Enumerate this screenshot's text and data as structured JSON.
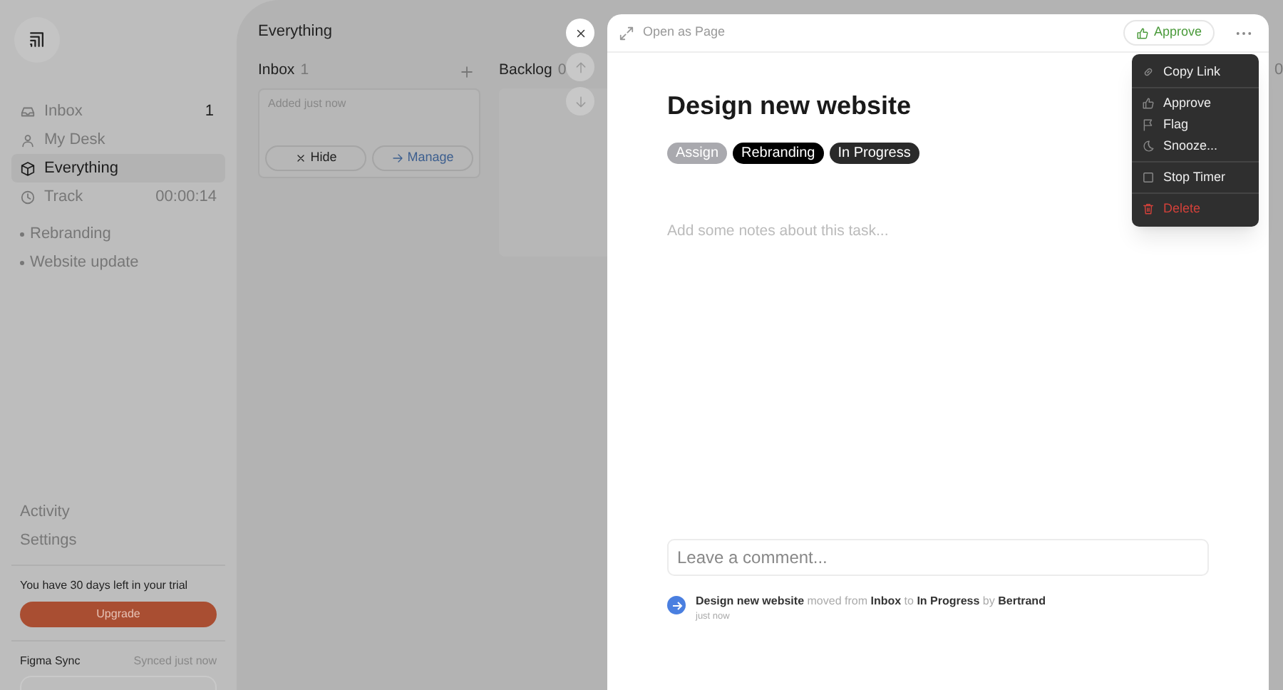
{
  "sidebar": {
    "nav": [
      {
        "label": "Inbox",
        "badge": "1",
        "selected": false
      },
      {
        "label": "My Desk",
        "selected": false
      },
      {
        "label": "Everything",
        "selected": true
      },
      {
        "label": "Track",
        "badge": "00:00:14",
        "selected": false
      }
    ],
    "projects": [
      "Rebranding",
      "Website update"
    ],
    "footer_links": [
      "Activity",
      "Settings"
    ],
    "trial": {
      "text": "You have 30 days left in your trial",
      "button": "Upgrade"
    },
    "sync": {
      "label": "Figma Sync",
      "status": "Synced just now"
    }
  },
  "board": {
    "title": "Everything",
    "columns": [
      {
        "name": "Inbox",
        "count": "1",
        "cards": [
          {
            "meta": "Added just now",
            "actions": [
              "Hide",
              "Manage"
            ]
          }
        ]
      },
      {
        "name": "Backlog",
        "count": "0"
      }
    ],
    "column_3_count": "0"
  },
  "task": {
    "open_label": "Open as Page",
    "approve": "Approve",
    "title": "Design new website",
    "tags": [
      {
        "label": "Assign",
        "kind": "placeholder"
      },
      {
        "label": "Rebranding",
        "kind": "project"
      },
      {
        "label": "In Progress",
        "kind": "status"
      }
    ],
    "notes_placeholder": "Add some notes about this task...",
    "comment_placeholder": "Leave a comment...",
    "activity": [
      {
        "text": "**Design new website** moved from **Inbox** to **In Progress** by **Bertrand**",
        "time": "just now"
      }
    ]
  },
  "menu": {
    "groups": [
      [
        {
          "label": "Copy Link",
          "kind": "normal"
        }
      ],
      [
        {
          "label": "Approve",
          "kind": "normal"
        },
        {
          "label": "Flag",
          "kind": "normal"
        },
        {
          "label": "Snooze...",
          "kind": "normal"
        }
      ],
      [
        {
          "label": "Stop Timer",
          "kind": "normal"
        }
      ],
      [
        {
          "label": "Delete",
          "kind": "danger"
        }
      ]
    ]
  }
}
